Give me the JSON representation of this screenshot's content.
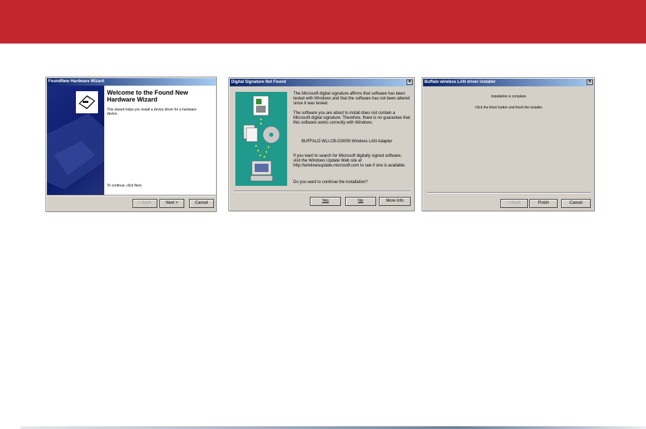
{
  "colors": {
    "banner": "#c4262e",
    "titlebar_start": "#0a246a",
    "dialog_bg": "#d4d0c8"
  },
  "wizard": {
    "title": "FoundNew Hardware Wizard",
    "heading": "Welcome to the Found New Hardware Wizard",
    "intro": "This wizard helps you install a device driver for a hardware device.",
    "continue_text": "To continue, click Next.",
    "back_label": "< Back",
    "next_label": "Next >",
    "cancel_label": "Cancel"
  },
  "signature": {
    "title": "Digital Signature Not Found",
    "para1": "The Microsoft digital signature affirms that software has been tested with Windows and that the software has not been altered since it was tested.",
    "para2": "The software you are about to install does not contain a Microsoft digital signature. Therefore, there is no guarantee that this software works correctly with Windows.",
    "device": "BUFFALO WLI-CB-G300N   Wireless LAN Adapter",
    "para3": "If you want to search for Microsoft digitally signed software, visit the Windows Update Web site at http://windowsupdate.microsoft.com to see if one is available.",
    "question": "Do you want to continue the installation?",
    "yes_label": "Yes",
    "no_label": "No",
    "more_label": "More Info"
  },
  "installer": {
    "title": "Buffalo wireless LAN driver installer",
    "line1": "Installation is complete.",
    "line2": "Click the finish button and finish the installer.",
    "back_label": "< Back",
    "finish_label": "Finish",
    "cancel_label": "Cancel"
  },
  "icons": [
    "close-icon",
    "hardware-wizard-icon",
    "signature-illustration"
  ]
}
